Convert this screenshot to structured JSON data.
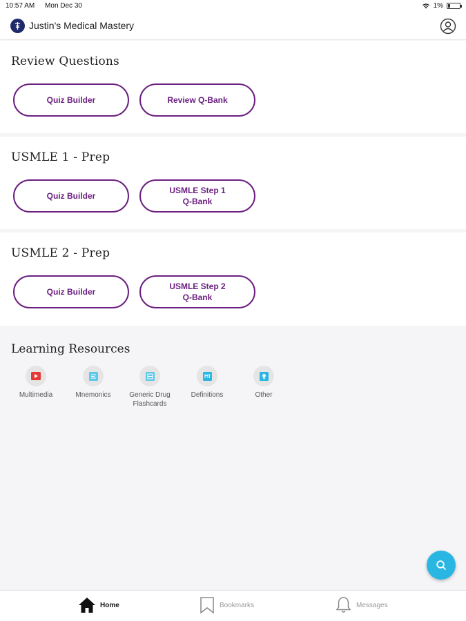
{
  "status_bar": {
    "time": "10:57 AM",
    "date": "Mon Dec 30",
    "battery": "1%"
  },
  "header": {
    "title": "Justin's Medical Mastery"
  },
  "sections": [
    {
      "title": "Review Questions",
      "buttons": [
        {
          "label": "Quiz Builder"
        },
        {
          "label": "Review Q-Bank"
        }
      ]
    },
    {
      "title": "USMLE 1 - Prep",
      "buttons": [
        {
          "label": "Quiz Builder"
        },
        {
          "label": "USMLE Step 1\nQ-Bank"
        }
      ]
    },
    {
      "title": "USMLE 2 - Prep",
      "buttons": [
        {
          "label": "Quiz Builder"
        },
        {
          "label": "USMLE Step 2\nQ-Bank"
        }
      ]
    }
  ],
  "resources": {
    "title": "Learning Resources",
    "items": [
      {
        "label": "Multimedia",
        "icon": "play-video-icon",
        "color": "#e53935"
      },
      {
        "label": "Mnemonics",
        "icon": "mnemonics-icon",
        "color": "#5ec8e8"
      },
      {
        "label": "Generic Drug Flashcards",
        "icon": "flashcards-icon",
        "color": "#5ec8e8"
      },
      {
        "label": "Definitions",
        "icon": "definitions-icon",
        "color": "#29b6e3"
      },
      {
        "label": "Other",
        "icon": "lightbulb-icon",
        "color": "#29b6e3"
      }
    ]
  },
  "tab_bar": {
    "items": [
      {
        "label": "Home",
        "icon": "home-icon",
        "active": true
      },
      {
        "label": "Bookmarks",
        "icon": "bookmark-icon",
        "active": false
      },
      {
        "label": "Messages",
        "icon": "bell-icon",
        "active": false
      }
    ]
  },
  "colors": {
    "accent": "#6b1f80",
    "fab": "#29b6e3",
    "logo": "#1f2a6b"
  },
  "fab": {
    "icon": "search-icon"
  }
}
